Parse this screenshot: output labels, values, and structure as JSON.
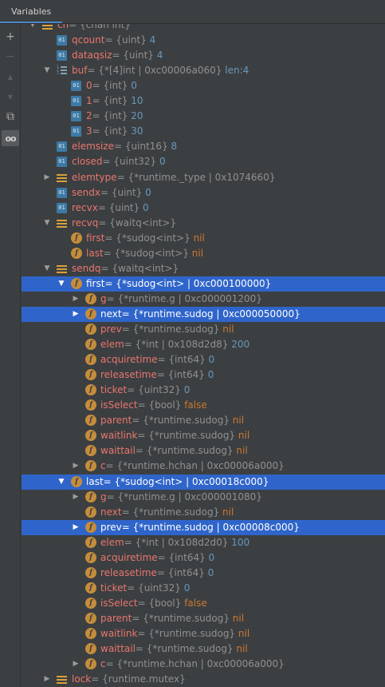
{
  "window": {
    "tab_title": "Variables"
  },
  "toolbar": [
    {
      "name": "add-watch-icon",
      "glyph": "+",
      "state": "normal"
    },
    {
      "name": "remove-watch-icon",
      "glyph": "−",
      "state": "dim"
    },
    {
      "name": "move-up-icon",
      "glyph": "▲",
      "state": "dim"
    },
    {
      "name": "move-down-icon",
      "glyph": "▼",
      "state": "dim"
    },
    {
      "name": "copy-icon",
      "glyph": "⧉",
      "state": "normal"
    },
    {
      "name": "glasses-icon",
      "glyph": "oo",
      "state": "active"
    }
  ],
  "tree": [
    {
      "depth": 0,
      "arrow": "expanded",
      "icon": "struct",
      "name": "ch",
      "type": "{chan int}",
      "value": "",
      "selected": false
    },
    {
      "depth": 1,
      "arrow": "none",
      "icon": "prim",
      "name": "qcount",
      "type": "{uint}",
      "value": "4",
      "selected": false
    },
    {
      "depth": 1,
      "arrow": "none",
      "icon": "prim",
      "name": "dataqsiz",
      "type": "{uint}",
      "value": "4",
      "selected": false
    },
    {
      "depth": 1,
      "arrow": "expanded",
      "icon": "array",
      "name": "buf",
      "type": "{*[4]int | 0xc00006a060}",
      "value": "len:4",
      "selected": false
    },
    {
      "depth": 2,
      "arrow": "none",
      "icon": "prim",
      "name": "0",
      "type": "{int}",
      "value": "0",
      "selected": false
    },
    {
      "depth": 2,
      "arrow": "none",
      "icon": "prim",
      "name": "1",
      "type": "{int}",
      "value": "10",
      "selected": false
    },
    {
      "depth": 2,
      "arrow": "none",
      "icon": "prim",
      "name": "2",
      "type": "{int}",
      "value": "20",
      "selected": false
    },
    {
      "depth": 2,
      "arrow": "none",
      "icon": "prim",
      "name": "3",
      "type": "{int}",
      "value": "30",
      "selected": false
    },
    {
      "depth": 1,
      "arrow": "none",
      "icon": "prim",
      "name": "elemsize",
      "type": "{uint16}",
      "value": "8",
      "selected": false
    },
    {
      "depth": 1,
      "arrow": "none",
      "icon": "prim",
      "name": "closed",
      "type": "{uint32}",
      "value": "0",
      "selected": false
    },
    {
      "depth": 1,
      "arrow": "collapsed",
      "icon": "struct",
      "name": "elemtype",
      "type": "{*runtime._type | 0x1074660}",
      "value": "",
      "selected": false
    },
    {
      "depth": 1,
      "arrow": "none",
      "icon": "prim",
      "name": "sendx",
      "type": "{uint}",
      "value": "0",
      "selected": false
    },
    {
      "depth": 1,
      "arrow": "none",
      "icon": "prim",
      "name": "recvx",
      "type": "{uint}",
      "value": "0",
      "selected": false
    },
    {
      "depth": 1,
      "arrow": "expanded",
      "icon": "struct",
      "name": "recvq",
      "type": "{waitq<int>}",
      "value": "",
      "selected": false
    },
    {
      "depth": 2,
      "arrow": "none",
      "icon": "field",
      "name": "first",
      "type": "{*sudog<int>}",
      "value": "nil",
      "selected": false
    },
    {
      "depth": 2,
      "arrow": "none",
      "icon": "field",
      "name": "last",
      "type": "{*sudog<int>}",
      "value": "nil",
      "selected": false
    },
    {
      "depth": 1,
      "arrow": "expanded",
      "icon": "struct",
      "name": "sendq",
      "type": "{waitq<int>}",
      "value": "",
      "selected": false
    },
    {
      "depth": 2,
      "arrow": "expanded",
      "icon": "field",
      "name": "first",
      "type": "{*sudog<int> | 0xc000100000}",
      "value": "",
      "selected": true
    },
    {
      "depth": 3,
      "arrow": "collapsed",
      "icon": "field",
      "name": "g",
      "type": "{*runtime.g | 0xc000001200}",
      "value": "",
      "selected": false
    },
    {
      "depth": 3,
      "arrow": "collapsed",
      "icon": "field",
      "name": "next",
      "type": "{*runtime.sudog | 0xc000050000}",
      "value": "",
      "selected": true
    },
    {
      "depth": 3,
      "arrow": "none",
      "icon": "field",
      "name": "prev",
      "type": "{*runtime.sudog}",
      "value": "nil",
      "selected": false
    },
    {
      "depth": 3,
      "arrow": "none",
      "icon": "field",
      "name": "elem",
      "type": "{*int | 0x108d2d8}",
      "value": "200",
      "selected": false
    },
    {
      "depth": 3,
      "arrow": "none",
      "icon": "field",
      "name": "acquiretime",
      "type": "{int64}",
      "value": "0",
      "selected": false
    },
    {
      "depth": 3,
      "arrow": "none",
      "icon": "field",
      "name": "releasetime",
      "type": "{int64}",
      "value": "0",
      "selected": false
    },
    {
      "depth": 3,
      "arrow": "none",
      "icon": "field",
      "name": "ticket",
      "type": "{uint32}",
      "value": "0",
      "selected": false
    },
    {
      "depth": 3,
      "arrow": "none",
      "icon": "field",
      "name": "isSelect",
      "type": "{bool}",
      "value": "false",
      "selected": false
    },
    {
      "depth": 3,
      "arrow": "none",
      "icon": "field",
      "name": "parent",
      "type": "{*runtime.sudog}",
      "value": "nil",
      "selected": false
    },
    {
      "depth": 3,
      "arrow": "none",
      "icon": "field",
      "name": "waitlink",
      "type": "{*runtime.sudog}",
      "value": "nil",
      "selected": false
    },
    {
      "depth": 3,
      "arrow": "none",
      "icon": "field",
      "name": "waittail",
      "type": "{*runtime.sudog}",
      "value": "nil",
      "selected": false
    },
    {
      "depth": 3,
      "arrow": "collapsed",
      "icon": "field",
      "name": "c",
      "type": "{*runtime.hchan | 0xc00006a000}",
      "value": "",
      "selected": false
    },
    {
      "depth": 2,
      "arrow": "expanded",
      "icon": "field",
      "name": "last",
      "type": "{*sudog<int> | 0xc00018c000}",
      "value": "",
      "selected": true
    },
    {
      "depth": 3,
      "arrow": "collapsed",
      "icon": "field",
      "name": "g",
      "type": "{*runtime.g | 0xc000001080}",
      "value": "",
      "selected": false
    },
    {
      "depth": 3,
      "arrow": "none",
      "icon": "field",
      "name": "next",
      "type": "{*runtime.sudog}",
      "value": "nil",
      "selected": false
    },
    {
      "depth": 3,
      "arrow": "collapsed",
      "icon": "field",
      "name": "prev",
      "type": "{*runtime.sudog | 0xc00008c000}",
      "value": "",
      "selected": true
    },
    {
      "depth": 3,
      "arrow": "none",
      "icon": "field",
      "name": "elem",
      "type": "{*int | 0x108d2d0}",
      "value": "100",
      "selected": false
    },
    {
      "depth": 3,
      "arrow": "none",
      "icon": "field",
      "name": "acquiretime",
      "type": "{int64}",
      "value": "0",
      "selected": false
    },
    {
      "depth": 3,
      "arrow": "none",
      "icon": "field",
      "name": "releasetime",
      "type": "{int64}",
      "value": "0",
      "selected": false
    },
    {
      "depth": 3,
      "arrow": "none",
      "icon": "field",
      "name": "ticket",
      "type": "{uint32}",
      "value": "0",
      "selected": false
    },
    {
      "depth": 3,
      "arrow": "none",
      "icon": "field",
      "name": "isSelect",
      "type": "{bool}",
      "value": "false",
      "selected": false
    },
    {
      "depth": 3,
      "arrow": "none",
      "icon": "field",
      "name": "parent",
      "type": "{*runtime.sudog}",
      "value": "nil",
      "selected": false
    },
    {
      "depth": 3,
      "arrow": "none",
      "icon": "field",
      "name": "waitlink",
      "type": "{*runtime.sudog}",
      "value": "nil",
      "selected": false
    },
    {
      "depth": 3,
      "arrow": "none",
      "icon": "field",
      "name": "waittail",
      "type": "{*runtime.sudog}",
      "value": "nil",
      "selected": false
    },
    {
      "depth": 3,
      "arrow": "collapsed",
      "icon": "field",
      "name": "c",
      "type": "{*runtime.hchan | 0xc00006a000}",
      "value": "",
      "selected": false
    },
    {
      "depth": 1,
      "arrow": "collapsed",
      "icon": "struct",
      "name": "lock",
      "type": "{runtime.mutex}",
      "value": "",
      "selected": false
    }
  ],
  "colors": {
    "background": "#3c3f41",
    "selection": "#2f65ca",
    "var_name": "#e8766f",
    "type_text": "#909090",
    "number_value": "#6897bb",
    "keyword_value": "#cc7832"
  }
}
